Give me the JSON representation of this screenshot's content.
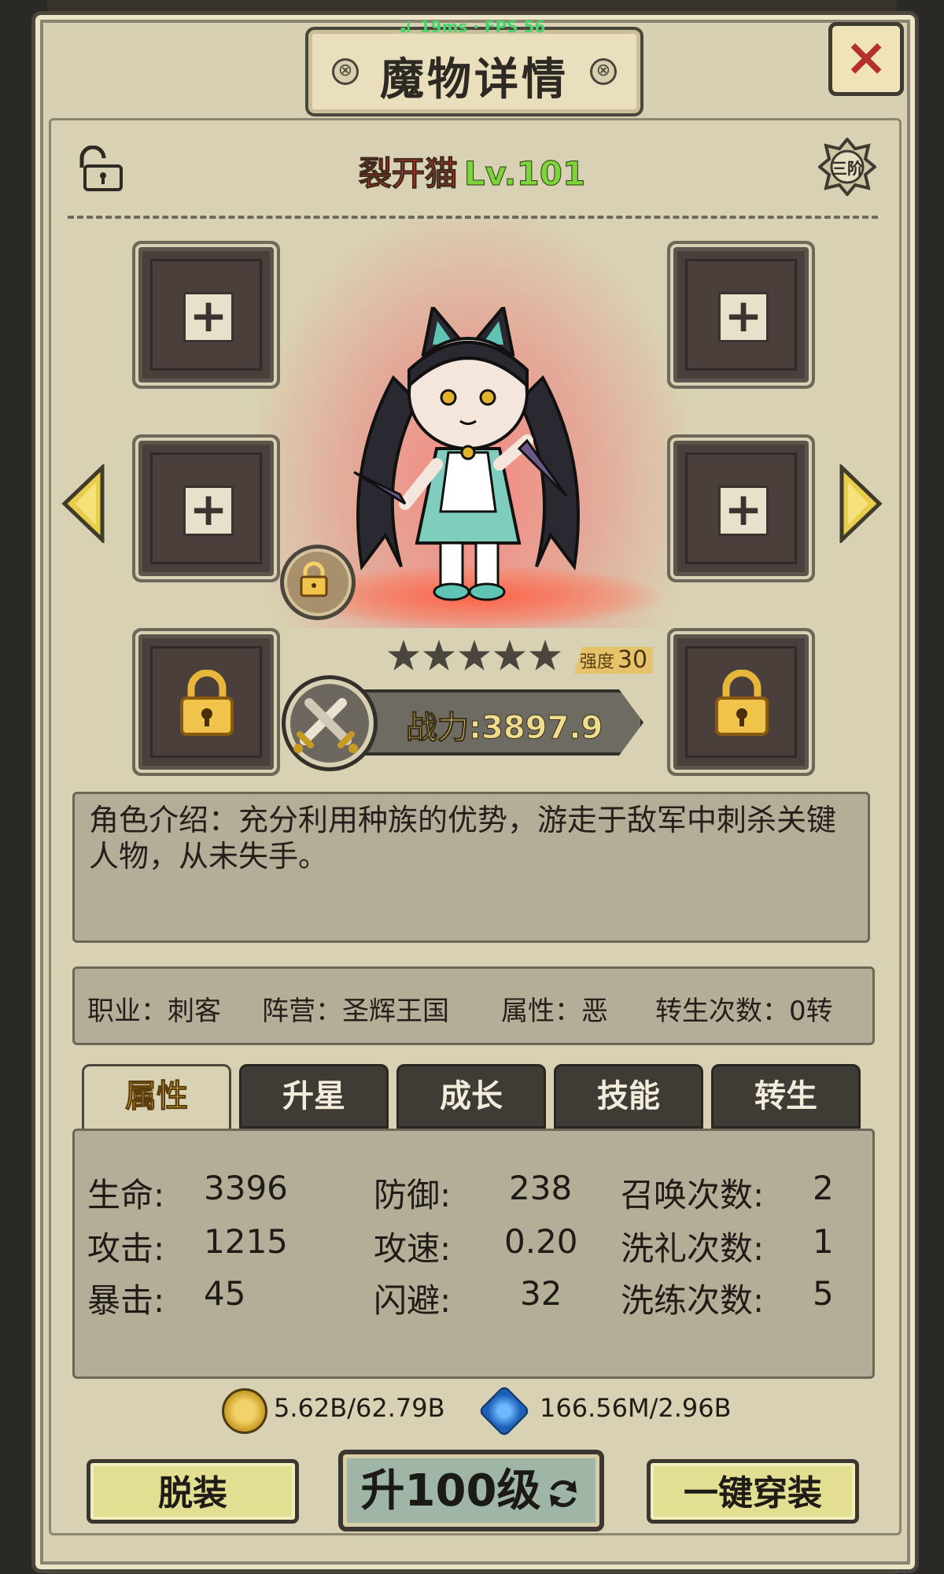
{
  "status": {
    "ping": "19ms",
    "separator": "·",
    "fps": "FPS 56"
  },
  "title": "魔物详情",
  "close_label": "×",
  "monster": {
    "name": "裂开猫",
    "level": "Lv.101",
    "tier": "三阶"
  },
  "stars": {
    "count": 5,
    "filled": 0
  },
  "strength": {
    "label": "强度",
    "value": "30"
  },
  "power": "战力:3897.9",
  "intro": "角色介绍：充分利用种族的优势，游走于敌军中刺杀关键人物，从未失手。",
  "info": {
    "job": "职业：刺客",
    "camp": "阵营：圣辉王国",
    "attr": "属性：恶",
    "rebirth": "转生次数：0转"
  },
  "tabs": [
    "属性",
    "升星",
    "成长",
    "技能",
    "转生"
  ],
  "stats": {
    "hp_label": "生命:",
    "hp": "3396",
    "atk_label": "攻击:",
    "atk": "1215",
    "crit_label": "暴击:",
    "crit": "45",
    "def_label": "防御:",
    "def": "238",
    "aspd_label": "攻速:",
    "aspd": "0.20",
    "dodge_label": "闪避:",
    "dodge": "32",
    "summon_label": "召唤次数:",
    "summon": "2",
    "baptism_label": "洗礼次数:",
    "baptism": "1",
    "refine_label": "洗练次数:",
    "refine": "5"
  },
  "currency": {
    "gold": "5.62B/62.79B",
    "gem": "166.56M/2.96B"
  },
  "buttons": {
    "unequip": "脱装",
    "upgrade": "升100级",
    "equip_all": "一键穿装"
  },
  "colors": {
    "name": "#e23b2a",
    "level": "#7cd33a",
    "active_tab": "#f2c33c",
    "close": "#b5302b"
  }
}
